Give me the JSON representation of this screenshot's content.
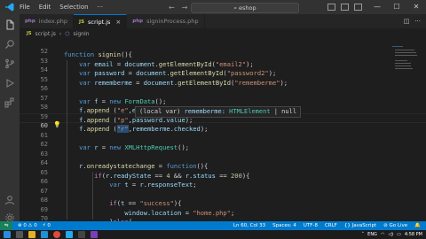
{
  "titlebar": {
    "menu": [
      "File",
      "Edit",
      "Selection"
    ],
    "search_text": "eshop"
  },
  "tabs": [
    {
      "ext": "php",
      "label": "index.php",
      "active": false
    },
    {
      "ext": "JS",
      "label": "script.js",
      "active": true
    },
    {
      "ext": "php",
      "label": "signinProcess.php",
      "active": false
    }
  ],
  "breadcrumb": {
    "file_ext": "JS",
    "file": "script.js",
    "symbol": "signIn"
  },
  "editor": {
    "line_numbers": [
      "52",
      "53",
      "54",
      "55",
      "56",
      "57",
      "58",
      "59",
      "60",
      "61",
      "62",
      "63",
      "64",
      "65",
      "66",
      "67",
      "68",
      "69",
      "70",
      "71"
    ],
    "current_line": "60",
    "tooltip": {
      "prefix": "(local var) ",
      "name": "rememberme",
      "sep": ": ",
      "type": "HTMLElement",
      "suffix": " | null"
    }
  },
  "statusbar": {
    "errors": "⊗ 0 ⚠ 0",
    "port": "⚡ 0",
    "position": "Ln 60, Col 33",
    "spaces": "Spaces: 4",
    "encoding": "UTF-8",
    "eol": "CRLF",
    "language": "{} JavaScript",
    "golive": "⊘ Go Live"
  },
  "taskbar": {
    "tray_lang": "ENG",
    "time": "4:58 PM"
  }
}
